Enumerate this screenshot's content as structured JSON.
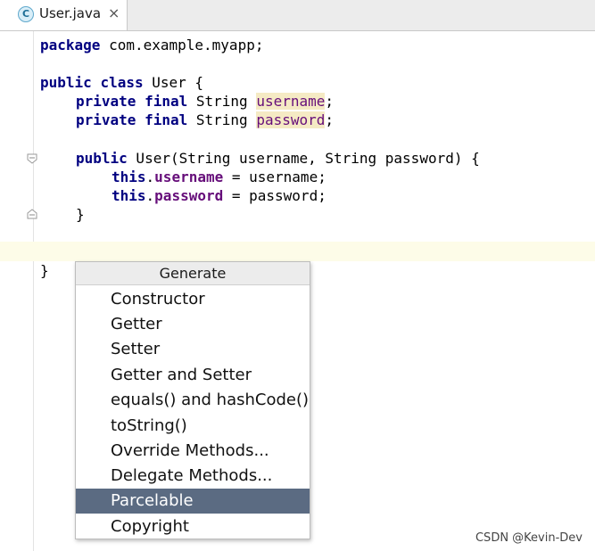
{
  "tab": {
    "icon": "java-class-icon",
    "icon_letter": "C",
    "label": "User.java",
    "close": "×"
  },
  "code": {
    "line1": {
      "kw": "package",
      "text": " com.example.myapp;"
    },
    "line3": {
      "kw1": "public",
      "kw2": "class",
      "text": " User {"
    },
    "line4": {
      "kw1": "private",
      "kw2": "final",
      "type": " String ",
      "field": "username",
      "end": ";"
    },
    "line5": {
      "kw1": "private",
      "kw2": "final",
      "type": " String ",
      "field": "password",
      "end": ";"
    },
    "line7": {
      "kw": "public",
      "text": " User(String username, String password) {"
    },
    "line8": {
      "kw": "this",
      "field": "username",
      "rest": " = username;"
    },
    "line9": {
      "kw": "this",
      "field": "password",
      "rest": " = password;"
    },
    "line10": "}",
    "line13": "}"
  },
  "popup": {
    "title": "Generate",
    "items": [
      "Constructor",
      "Getter",
      "Setter",
      "Getter and Setter",
      "equals() and hashCode()",
      "toString()",
      "Override Methods...",
      "Delegate Methods...",
      "Parcelable",
      "Copyright"
    ],
    "selected": "Parcelable"
  },
  "watermark": "CSDN @Kevin-Dev"
}
